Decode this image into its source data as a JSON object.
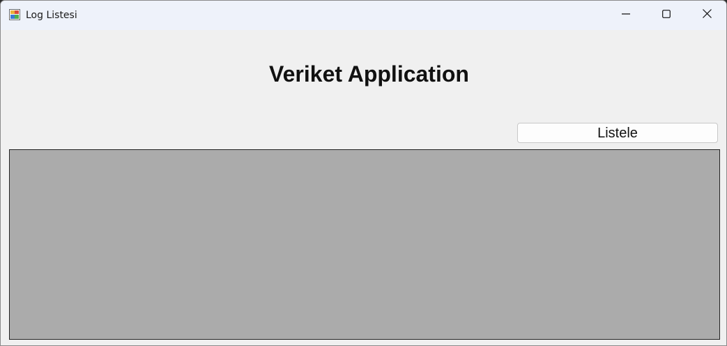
{
  "window": {
    "title": "Log Listesi",
    "icons": {
      "app": "form-app-icon",
      "minimize": "minimize-icon",
      "maximize": "maximize-icon",
      "close": "close-icon"
    }
  },
  "main": {
    "heading": "Veriket Application",
    "list_button_label": "Listele"
  },
  "grid": {
    "background_color": "#ababab",
    "rows": []
  }
}
